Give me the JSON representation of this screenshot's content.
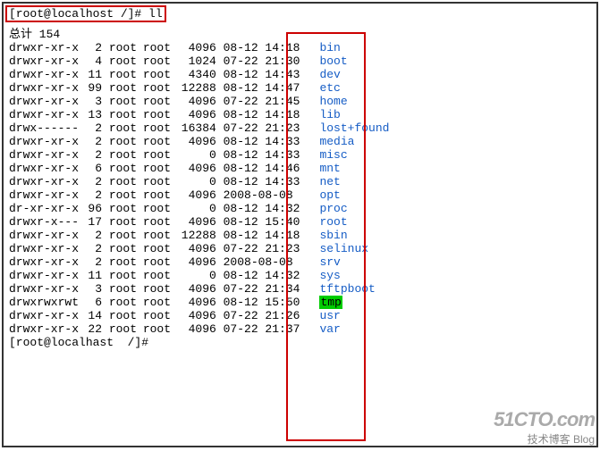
{
  "prompt": "[root@localhost /]# ll",
  "total": "总计 154",
  "lastline": "[root@localhast  /]#",
  "watermark": {
    "logo": "51CTO.com",
    "sub": "技术博客  Blog"
  },
  "rows": [
    {
      "perms": "drwxr-xr-x",
      "links": "2",
      "owner": "root",
      "group": "root",
      "size": "4096",
      "date": "08-12 14:18",
      "name": "bin",
      "cls": "name"
    },
    {
      "perms": "drwxr-xr-x",
      "links": "4",
      "owner": "root",
      "group": "root",
      "size": "1024",
      "date": "07-22 21:30",
      "name": "boot",
      "cls": "name"
    },
    {
      "perms": "drwxr-xr-x",
      "links": "11",
      "owner": "root",
      "group": "root",
      "size": "4340",
      "date": "08-12 14:43",
      "name": "dev",
      "cls": "name"
    },
    {
      "perms": "drwxr-xr-x",
      "links": "99",
      "owner": "root",
      "group": "root",
      "size": "12288",
      "date": "08-12 14:47",
      "name": "etc",
      "cls": "name"
    },
    {
      "perms": "drwxr-xr-x",
      "links": "3",
      "owner": "root",
      "group": "root",
      "size": "4096",
      "date": "07-22 21:45",
      "name": "home",
      "cls": "name"
    },
    {
      "perms": "drwxr-xr-x",
      "links": "13",
      "owner": "root",
      "group": "root",
      "size": "4096",
      "date": "08-12 14:18",
      "name": "lib",
      "cls": "name"
    },
    {
      "perms": "drwx------",
      "links": "2",
      "owner": "root",
      "group": "root",
      "size": "16384",
      "date": "07-22 21:23",
      "name": "lost+found",
      "cls": "name"
    },
    {
      "perms": "drwxr-xr-x",
      "links": "2",
      "owner": "root",
      "group": "root",
      "size": "4096",
      "date": "08-12 14:33",
      "name": "media",
      "cls": "name"
    },
    {
      "perms": "drwxr-xr-x",
      "links": "2",
      "owner": "root",
      "group": "root",
      "size": "0",
      "date": "08-12 14:33",
      "name": "misc",
      "cls": "name"
    },
    {
      "perms": "drwxr-xr-x",
      "links": "6",
      "owner": "root",
      "group": "root",
      "size": "4096",
      "date": "08-12 14:46",
      "name": "mnt",
      "cls": "name"
    },
    {
      "perms": "drwxr-xr-x",
      "links": "2",
      "owner": "root",
      "group": "root",
      "size": "0",
      "date": "08-12 14:33",
      "name": "net",
      "cls": "name"
    },
    {
      "perms": "drwxr-xr-x",
      "links": "2",
      "owner": "root",
      "group": "root",
      "size": "4096",
      "date": "2008-08-08",
      "name": "opt",
      "cls": "name"
    },
    {
      "perms": "dr-xr-xr-x",
      "links": "96",
      "owner": "root",
      "group": "root",
      "size": "0",
      "date": "08-12 14:32",
      "name": "proc",
      "cls": "name"
    },
    {
      "perms": "drwxr-x---",
      "links": "17",
      "owner": "root",
      "group": "root",
      "size": "4096",
      "date": "08-12 15:40",
      "name": "root",
      "cls": "name"
    },
    {
      "perms": "drwxr-xr-x",
      "links": "2",
      "owner": "root",
      "group": "root",
      "size": "12288",
      "date": "08-12 14:18",
      "name": "sbin",
      "cls": "name"
    },
    {
      "perms": "drwxr-xr-x",
      "links": "2",
      "owner": "root",
      "group": "root",
      "size": "4096",
      "date": "07-22 21:23",
      "name": "selinux",
      "cls": "name"
    },
    {
      "perms": "drwxr-xr-x",
      "links": "2",
      "owner": "root",
      "group": "root",
      "size": "4096",
      "date": "2008-08-08",
      "name": "srv",
      "cls": "name"
    },
    {
      "perms": "drwxr-xr-x",
      "links": "11",
      "owner": "root",
      "group": "root",
      "size": "0",
      "date": "08-12 14:32",
      "name": "sys",
      "cls": "name"
    },
    {
      "perms": "drwxr-xr-x",
      "links": "3",
      "owner": "root",
      "group": "root",
      "size": "4096",
      "date": "07-22 21:34",
      "name": "tftpboot",
      "cls": "name"
    },
    {
      "perms": "drwxrwxrwt",
      "links": "6",
      "owner": "root",
      "group": "root",
      "size": "4096",
      "date": "08-12 15:50",
      "name": "tmp",
      "cls": "name-tmp"
    },
    {
      "perms": "drwxr-xr-x",
      "links": "14",
      "owner": "root",
      "group": "root",
      "size": "4096",
      "date": "07-22 21:26",
      "name": "usr",
      "cls": "name"
    },
    {
      "perms": "drwxr-xr-x",
      "links": "22",
      "owner": "root",
      "group": "root",
      "size": "4096",
      "date": "07-22 21:37",
      "name": "var",
      "cls": "name"
    }
  ]
}
